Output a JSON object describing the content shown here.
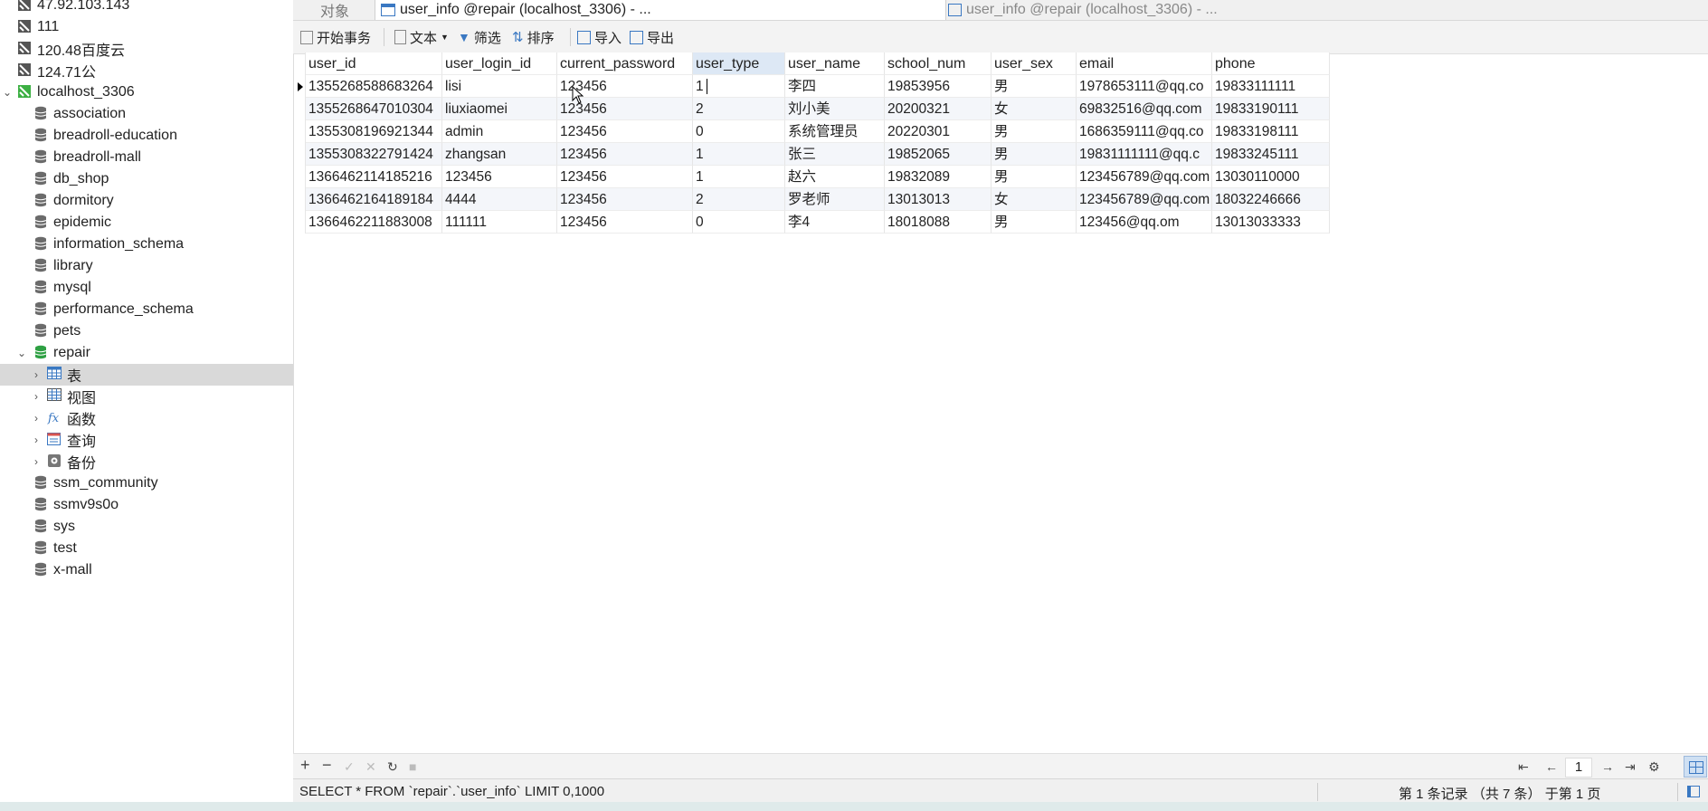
{
  "sidebar": {
    "connections_top": [
      "47.92.103.143",
      "111",
      "120.48百度云",
      "124.71公"
    ],
    "connection": "localhost_3306",
    "databases_before": [
      "association",
      "breadroll-education",
      "breadroll-mall",
      "db_shop",
      "dormitory",
      "epidemic",
      "information_schema",
      "library",
      "mysql",
      "performance_schema",
      "pets"
    ],
    "open_db": "repair",
    "open_db_children": [
      "表",
      "视图",
      "函数",
      "查询",
      "备份"
    ],
    "databases_after": [
      "ssm_community",
      "ssmv9s0o",
      "sys",
      "test",
      "x-mall"
    ]
  },
  "tabs": {
    "objects": "对象",
    "tab1": "user_info @repair (localhost_3306) - ...",
    "tab2": "user_info @repair (localhost_3306) - ..."
  },
  "toolbar": {
    "begin_tx": "开始事务",
    "text": "文本",
    "filter": "筛选",
    "sort": "排序",
    "import": "导入",
    "export": "导出"
  },
  "grid": {
    "columns": [
      "user_id",
      "user_login_id",
      "current_password",
      "user_type",
      "user_name",
      "school_num",
      "user_sex",
      "email",
      "phone"
    ],
    "rows": [
      [
        "1355268588683264",
        "lisi",
        "123456",
        "1",
        "李四",
        "19853956",
        "男",
        "1978653111@qq.co",
        "19833111111"
      ],
      [
        "1355268647010304",
        "liuxiaomei",
        "123456",
        "2",
        "刘小美",
        "20200321",
        "女",
        "69832516@qq.com",
        "19833190111"
      ],
      [
        "1355308196921344",
        "admin",
        "123456",
        "0",
        "系统管理员",
        "20220301",
        "男",
        "1686359111@qq.co",
        "19833198111"
      ],
      [
        "1355308322791424",
        "zhangsan",
        "123456",
        "1",
        "张三",
        "19852065",
        "男",
        "19831111111@qq.c",
        "19833245111"
      ],
      [
        "1366462114185216",
        "123456",
        "123456",
        "1",
        "赵六",
        "19832089",
        "男",
        "123456789@qq.com",
        "13030110000"
      ],
      [
        "1366462164189184",
        "4444",
        "123456",
        "2",
        "罗老师",
        "13013013",
        "女",
        "123456789@qq.com",
        "18032246666"
      ],
      [
        "1366462211883008",
        "111111",
        "123456",
        "0",
        "李4",
        "18018088",
        "男",
        "123456@qq.om",
        "13013033333"
      ]
    ]
  },
  "navigation": {
    "page": "1"
  },
  "status": {
    "sql": "SELECT * FROM `repair`.`user_info` LIMIT 0,1000",
    "record": "第 1 条记录 （共 7 条） 于第 1 页"
  }
}
